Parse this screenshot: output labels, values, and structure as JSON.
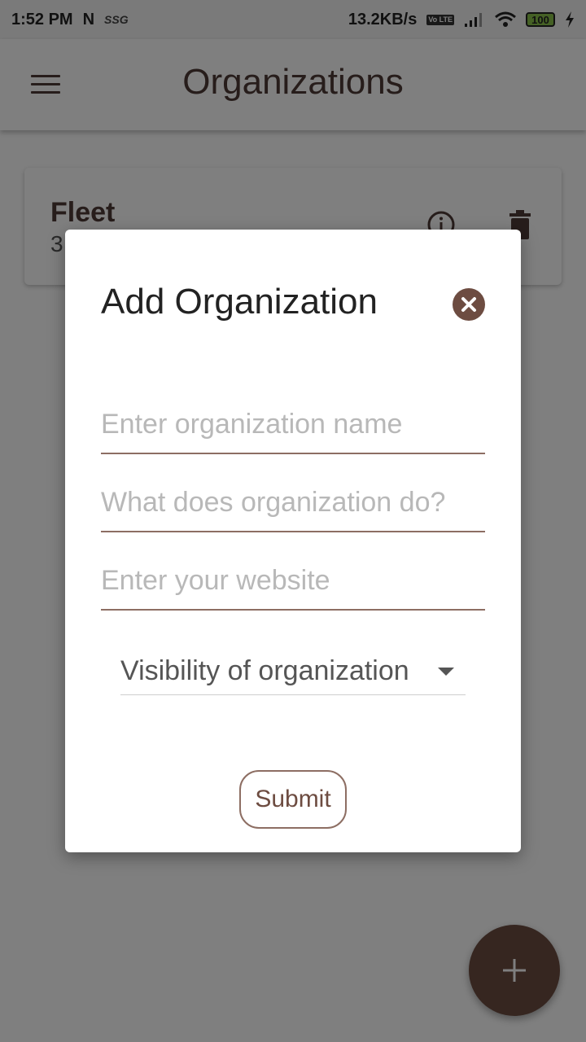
{
  "status_bar": {
    "time": "1:52 PM",
    "carrier_icon": "N",
    "extra": "SSG",
    "network_speed": "13.2KB/s",
    "lte_badge": "Vo LTE",
    "battery": "100"
  },
  "app_bar": {
    "title": "Organizations",
    "menu_icon": "hamburger-menu-icon"
  },
  "card": {
    "title": "Fleet",
    "subtitle": "3",
    "info_icon": "info-icon",
    "delete_icon": "trash-icon"
  },
  "dialog": {
    "title": "Add Organization",
    "close_icon": "close-icon",
    "fields": {
      "name_placeholder": "Enter organization name",
      "description_placeholder": "What does organization do?",
      "website_placeholder": "Enter your website"
    },
    "visibility": {
      "label": "Visibility of organization"
    },
    "submit_label": "Submit"
  },
  "fab": {
    "icon": "plus-icon"
  },
  "colors": {
    "accent": "#6d4c41",
    "title_text": "#4e3b36",
    "underline": "#8d6e63",
    "placeholder": "#b8b8b8"
  }
}
